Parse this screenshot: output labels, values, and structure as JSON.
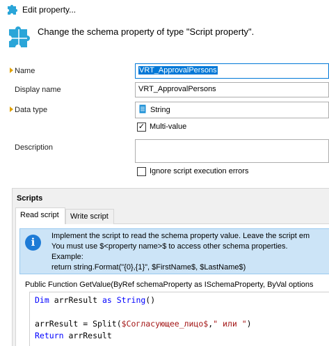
{
  "window": {
    "title": "Edit property..."
  },
  "header": {
    "text": "Change the schema property of type \"Script property\"."
  },
  "form": {
    "name": {
      "label": "Name",
      "value": "VRT_ApprovalPersons"
    },
    "display_name": {
      "label": "Display name",
      "value": "VRT_ApprovalPersons"
    },
    "data_type": {
      "label": "Data type",
      "value": "String",
      "icon": "document-icon"
    },
    "multi_value": {
      "label": "Multi-value",
      "checked": true
    },
    "description": {
      "label": "Description",
      "value": ""
    },
    "ignore_errors": {
      "label": "Ignore script execution errors",
      "checked": false
    }
  },
  "scripts": {
    "title": "Scripts",
    "tabs": [
      {
        "label": "Read script",
        "active": true
      },
      {
        "label": "Write script",
        "active": false
      }
    ],
    "info": {
      "lines": [
        "Implement the script to read the schema property value. Leave the script em",
        "You must use $<property name>$ to access other schema properties.",
        "Example:",
        "return string.Format(\"{0},{1}\", $FirstName$, $LastName$)"
      ]
    },
    "signature": "Public Function GetValue(ByRef schemaProperty as ISchemaProperty, ByVal options",
    "code": {
      "line1_kw1": "Dim",
      "line1_mid": " arrResult ",
      "line1_kw2": "as",
      "line1_sp": " ",
      "line1_kw3": "String",
      "line1_end": "()",
      "line3_a": "arrResult = Split(",
      "line3_str1": "$Согласующее_лицо$",
      "line3_b": ",",
      "line3_str2": "\" или \"",
      "line3_c": ")",
      "line4_kw": "Return",
      "line4_rest": " arrResult"
    }
  },
  "colors": {
    "accent": "#0078d7",
    "info_bg": "#cce4f7",
    "keyword": "#0000ff",
    "string": "#a31515",
    "marker": "#e0a100"
  }
}
